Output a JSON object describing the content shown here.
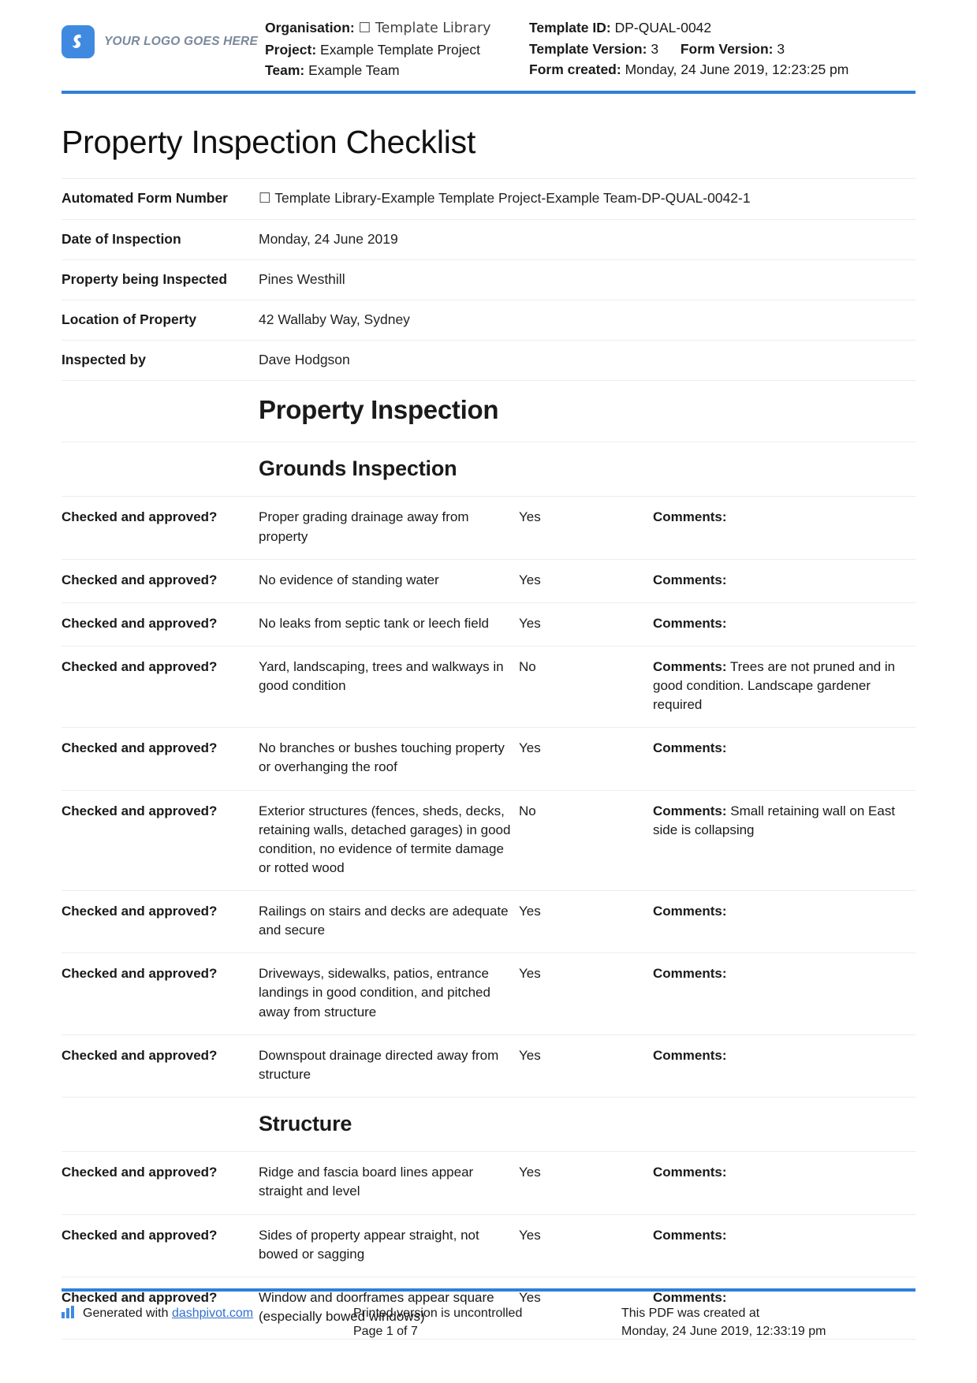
{
  "header": {
    "logo_text": "YOUR LOGO GOES HERE",
    "organisation_label": "Organisation:",
    "organisation_value": "☐ Template Library",
    "project_label": "Project:",
    "project_value": "Example Template Project",
    "team_label": "Team:",
    "team_value": "Example Team",
    "template_id_label": "Template ID:",
    "template_id_value": "DP-QUAL-0042",
    "template_version_label": "Template Version:",
    "template_version_value": "3",
    "form_version_label": "Form Version:",
    "form_version_value": "3",
    "form_created_label": "Form created:",
    "form_created_value": "Monday, 24 June 2019, 12:23:25 pm"
  },
  "title": "Property Inspection Checklist",
  "info": {
    "rows": [
      {
        "key": "Automated Form Number",
        "value": "☐ Template Library-Example Template Project-Example Team-DP-QUAL-0042-1"
      },
      {
        "key": "Date of Inspection",
        "value": "Monday, 24 June 2019"
      },
      {
        "key": "Property being Inspected",
        "value": "Pines Westhill"
      },
      {
        "key": "Location of Property",
        "value": "42 Wallaby Way, Sydney"
      },
      {
        "key": "Inspected by",
        "value": "Dave Hodgson"
      }
    ]
  },
  "main_section_title": "Property Inspection",
  "sections": [
    {
      "title": "Grounds Inspection",
      "rows": [
        {
          "label": "Checked and approved?",
          "description": "Proper grading drainage away from property",
          "answer": "Yes",
          "comments_label": "Comments:",
          "comments_value": ""
        },
        {
          "label": "Checked and approved?",
          "description": "No evidence of standing water",
          "answer": "Yes",
          "comments_label": "Comments:",
          "comments_value": ""
        },
        {
          "label": "Checked and approved?",
          "description": "No leaks from septic tank or leech field",
          "answer": "Yes",
          "comments_label": "Comments:",
          "comments_value": ""
        },
        {
          "label": "Checked and approved?",
          "description": "Yard, landscaping, trees and walkways in good condition",
          "answer": "No",
          "comments_label": "Comments:",
          "comments_value": " Trees are not pruned and in good condition. Landscape gardener required"
        },
        {
          "label": "Checked and approved?",
          "description": "No branches or bushes touching property or overhanging the roof",
          "answer": "Yes",
          "comments_label": "Comments:",
          "comments_value": ""
        },
        {
          "label": "Checked and approved?",
          "description": "Exterior structures (fences, sheds, decks, retaining walls, detached garages) in good condition, no evidence of termite damage or rotted wood",
          "answer": "No",
          "comments_label": "Comments:",
          "comments_value": " Small retaining wall on East side is collapsing"
        },
        {
          "label": "Checked and approved?",
          "description": "Railings on stairs and decks are adequate and secure",
          "answer": "Yes",
          "comments_label": "Comments:",
          "comments_value": ""
        },
        {
          "label": "Checked and approved?",
          "description": "Driveways, sidewalks, patios, entrance landings in good condition, and pitched away from structure",
          "answer": "Yes",
          "comments_label": "Comments:",
          "comments_value": ""
        },
        {
          "label": "Checked and approved?",
          "description": "Downspout drainage directed away from structure",
          "answer": "Yes",
          "comments_label": "Comments:",
          "comments_value": ""
        }
      ]
    },
    {
      "title": "Structure",
      "rows": [
        {
          "label": "Checked and approved?",
          "description": "Ridge and fascia board lines appear straight and level",
          "answer": "Yes",
          "comments_label": "Comments:",
          "comments_value": ""
        },
        {
          "label": "Checked and approved?",
          "description": "Sides of property appear straight, not bowed or sagging",
          "answer": "Yes",
          "comments_label": "Comments:",
          "comments_value": ""
        },
        {
          "label": "Checked and approved?",
          "description": "Window and doorframes appear square (especially bowed windows)",
          "answer": "Yes",
          "comments_label": "Comments:",
          "comments_value": ""
        }
      ]
    }
  ],
  "footer": {
    "generated_prefix": "Generated with ",
    "generated_link": "dashpivot.com",
    "uncontrolled_text": "Printed version is uncontrolled",
    "page_text": "Page 1 of 7",
    "created_text": "This PDF was created at",
    "created_time": "Monday, 24 June 2019, 12:33:19 pm"
  },
  "colors": {
    "accent": "#2f80d8",
    "logo": "#3f8ae0",
    "link": "#2f6fd0",
    "rule": "#ededef"
  }
}
